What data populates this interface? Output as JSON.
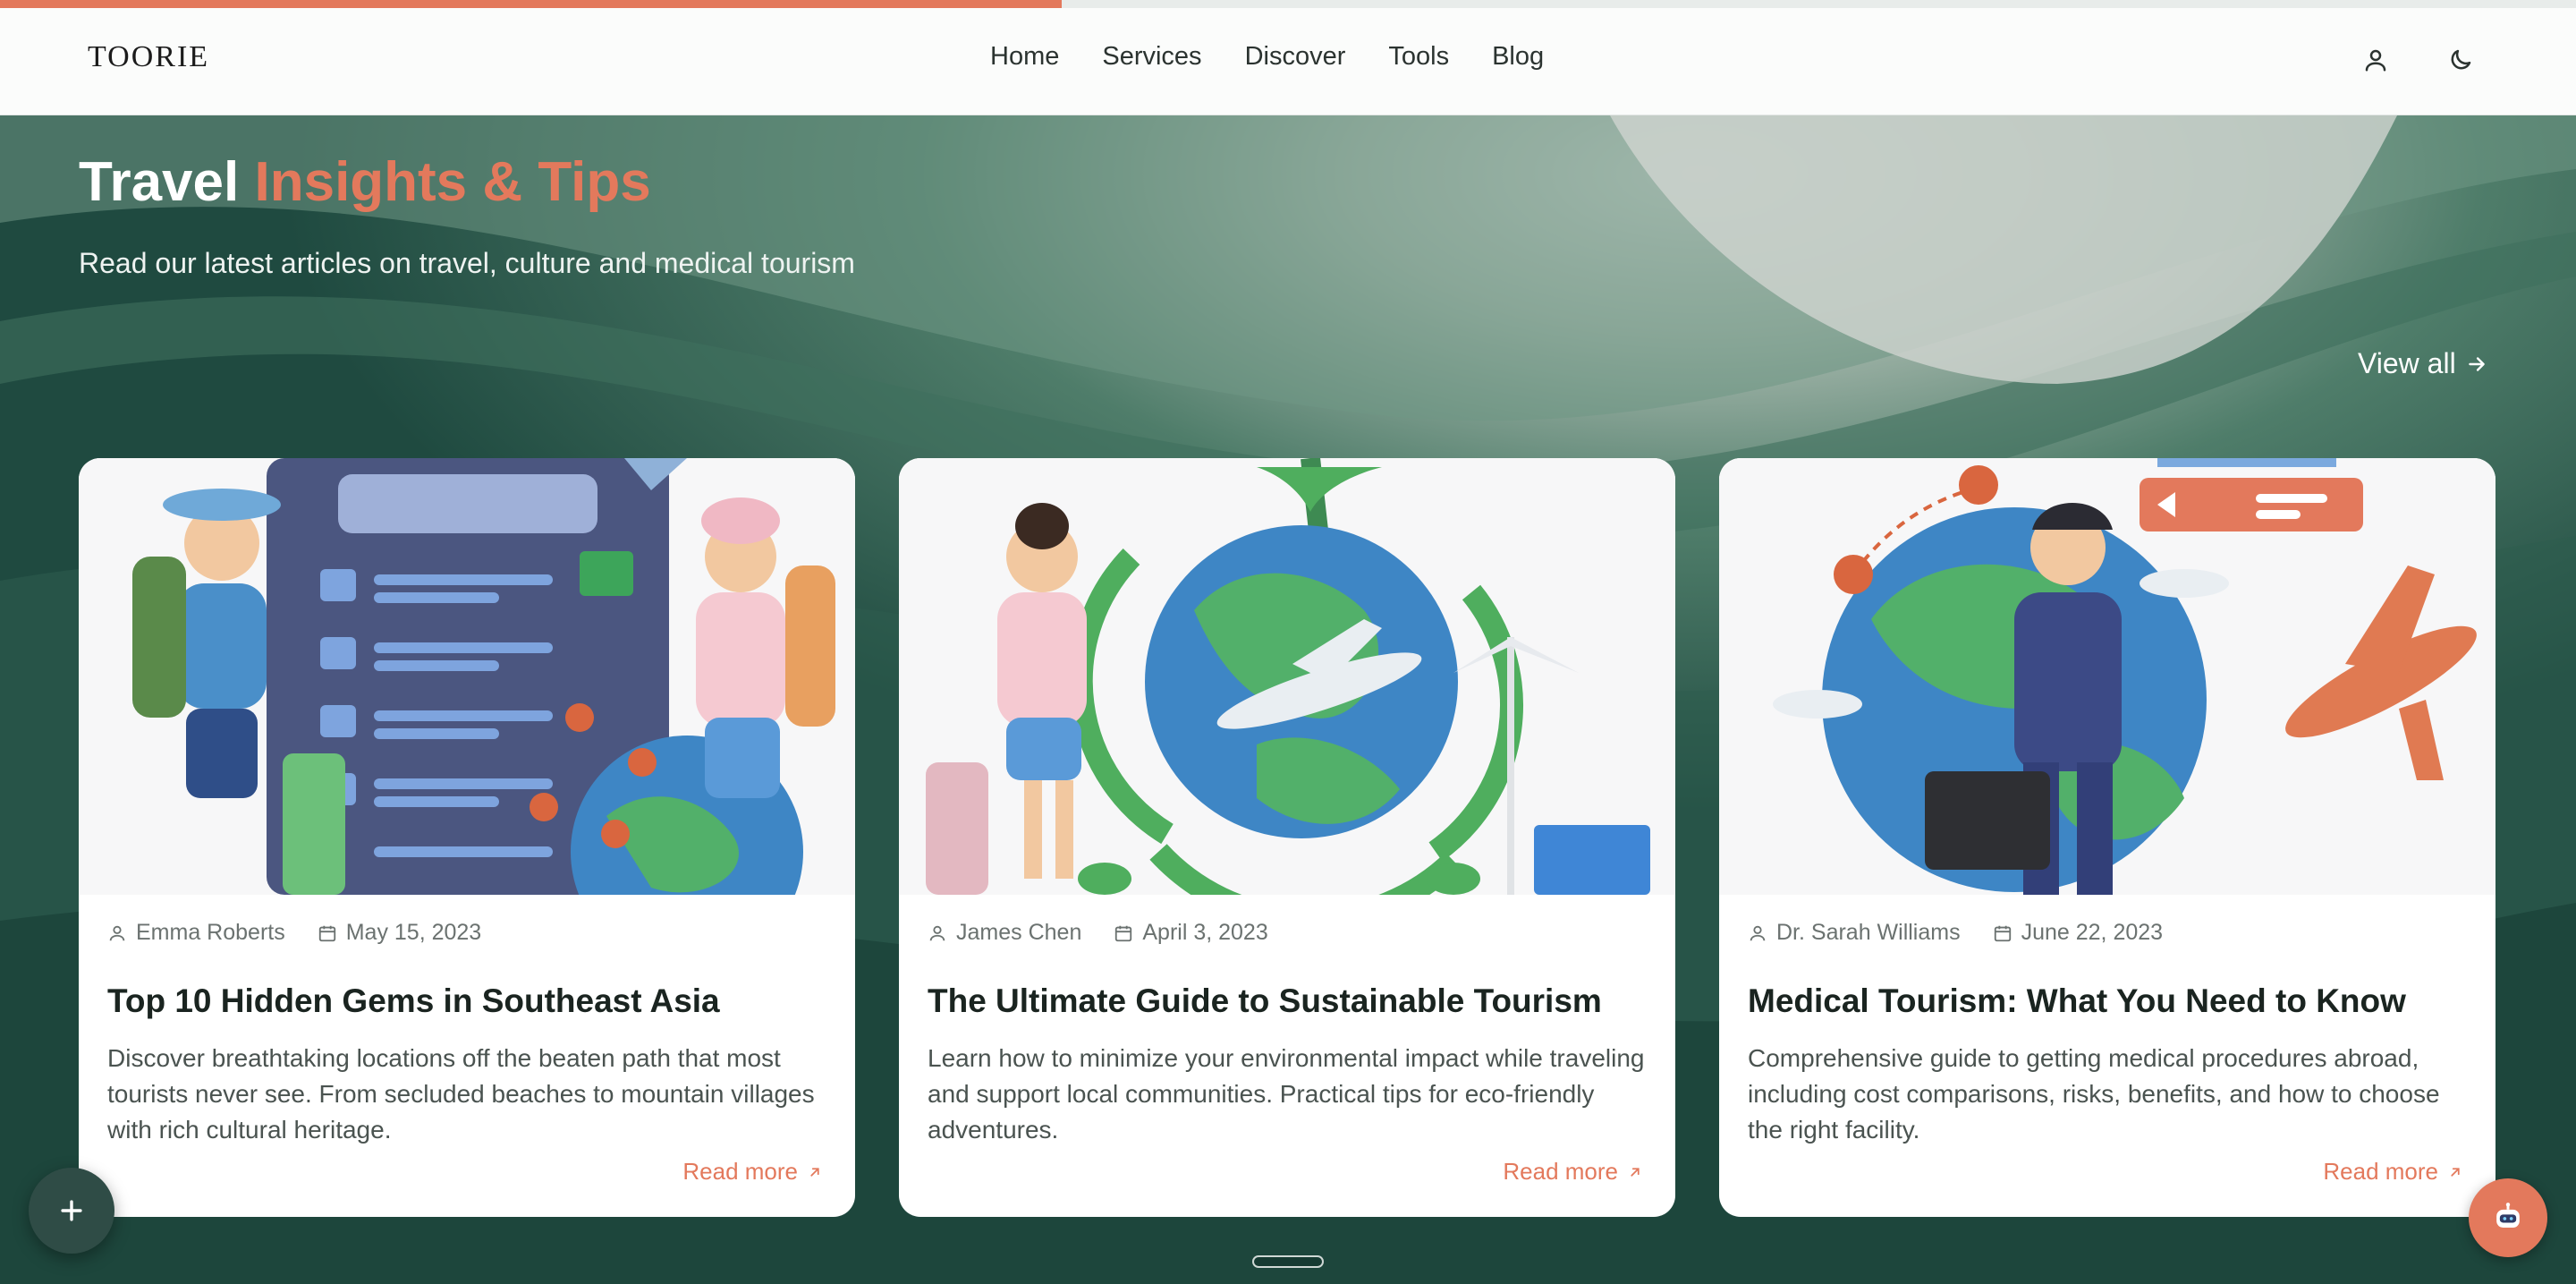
{
  "progress": {
    "fraction": 0.412
  },
  "navbar": {
    "logo": "TOORIE",
    "links": [
      "Home",
      "Services",
      "Discover",
      "Tools",
      "Blog"
    ],
    "icons": [
      "user-icon",
      "moon-icon"
    ]
  },
  "hero": {
    "title_white": "Travel",
    "title_accent": "Insights & Tips",
    "subtitle": "Read our latest articles on travel, culture and medical tourism",
    "view_all": "View all"
  },
  "cards": [
    {
      "author": "Emma Roberts",
      "date": "May 15, 2023",
      "title": "Top 10 Hidden Gems in Southeast Asia",
      "description": "Discover breathtaking locations off the beaten path that most tourists never see. From secluded beaches to mountain villages with rich cultural heritage.",
      "read_more": "Read more"
    },
    {
      "author": "James Chen",
      "date": "April 3, 2023",
      "title": "The Ultimate Guide to Sustainable Tourism",
      "description": "Learn how to minimize your environmental impact while traveling and support local communities. Practical tips for eco-friendly adventures.",
      "read_more": "Read more"
    },
    {
      "author": "Dr. Sarah Williams",
      "date": "June 22, 2023",
      "title": "Medical Tourism: What You Need to Know",
      "description": "Comprehensive guide to getting medical procedures abroad, including cost comparisons, risks, benefits, and how to choose the right facility.",
      "read_more": "Read more"
    }
  ],
  "colors": {
    "accent": "#e3795c",
    "hero_bg": "#1f4a40",
    "card_bg": "#ffffff"
  }
}
